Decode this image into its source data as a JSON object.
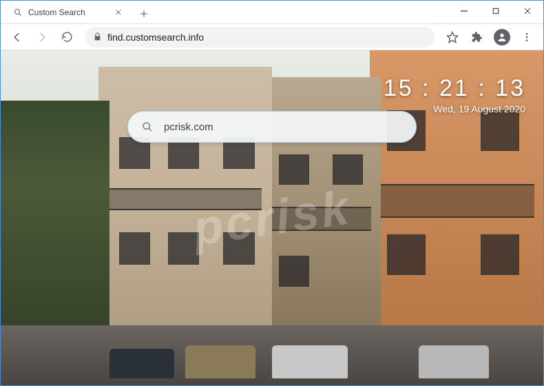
{
  "tab": {
    "title": "Custom Search"
  },
  "address": {
    "url": "find.customsearch.info"
  },
  "clock": {
    "time": "15 : 21 : 13",
    "date": "Wed, 19 August 2020"
  },
  "search": {
    "value": "pcrisk.com",
    "placeholder": ""
  },
  "watermark": "pcrisk"
}
